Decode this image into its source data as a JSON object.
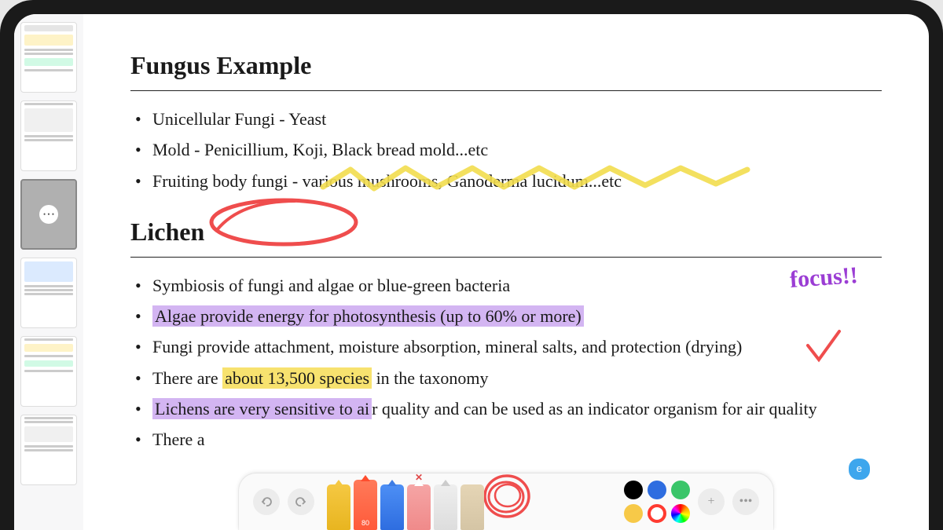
{
  "section1": {
    "title": "Fungus Example",
    "items": [
      "Unicellular Fungi - Yeast",
      "Mold - Penicillium, Koji, Black bread mold...etc",
      "Fruiting body fungi - various mushrooms, Ganoderma lucidum...etc"
    ]
  },
  "section2": {
    "title": "Lichen",
    "items": [
      {
        "text": "Symbiosis of fungi and algae or blue-green bacteria"
      },
      {
        "text": "Algae provide energy for photosynthesis (up to 60% or more)",
        "row_hl": "purple"
      },
      {
        "text": "Fungi provide attachment, moisture absorption, mineral salts, and protection (drying)"
      },
      {
        "pre": "There are ",
        "mark": "about 13,500 species",
        "post": " in the taxonomy",
        "mark_hl": "yellow"
      },
      {
        "pre_hl": "Lichens are very sensitive to ai",
        "post": "r quality and can be used as an indicator organism for air quality",
        "row_hl_partial": "purple"
      },
      {
        "text": "There a"
      }
    ]
  },
  "handwriting": {
    "focus": "focus!!"
  },
  "toolbar": {
    "size_label": "80",
    "colors": [
      "#000000",
      "#2e6de0",
      "#3ac569",
      "#f7c948",
      "#ff3b30",
      "wheel"
    ]
  },
  "tag": "e"
}
